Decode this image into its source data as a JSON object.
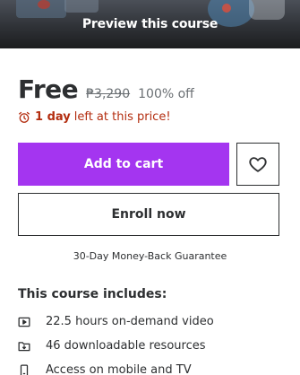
{
  "preview": {
    "label": "Preview this course"
  },
  "pricing": {
    "current": "Free",
    "original": "₱3,290",
    "discount": "100% off"
  },
  "timer": {
    "strong": "1 day",
    "text": "left at this price!",
    "color": "#b32d0f"
  },
  "buttons": {
    "add_to_cart": "Add to cart",
    "enroll": "Enroll now",
    "accent": "#a435f0"
  },
  "guarantee": "30-Day Money-Back Guarantee",
  "includes": {
    "title": "This course includes:",
    "items": [
      {
        "icon": "video-play-icon",
        "text": "22.5 hours on-demand video"
      },
      {
        "icon": "download-folder-icon",
        "text": "46 downloadable resources"
      },
      {
        "icon": "mobile-device-icon",
        "text": "Access on mobile and TV"
      }
    ]
  }
}
